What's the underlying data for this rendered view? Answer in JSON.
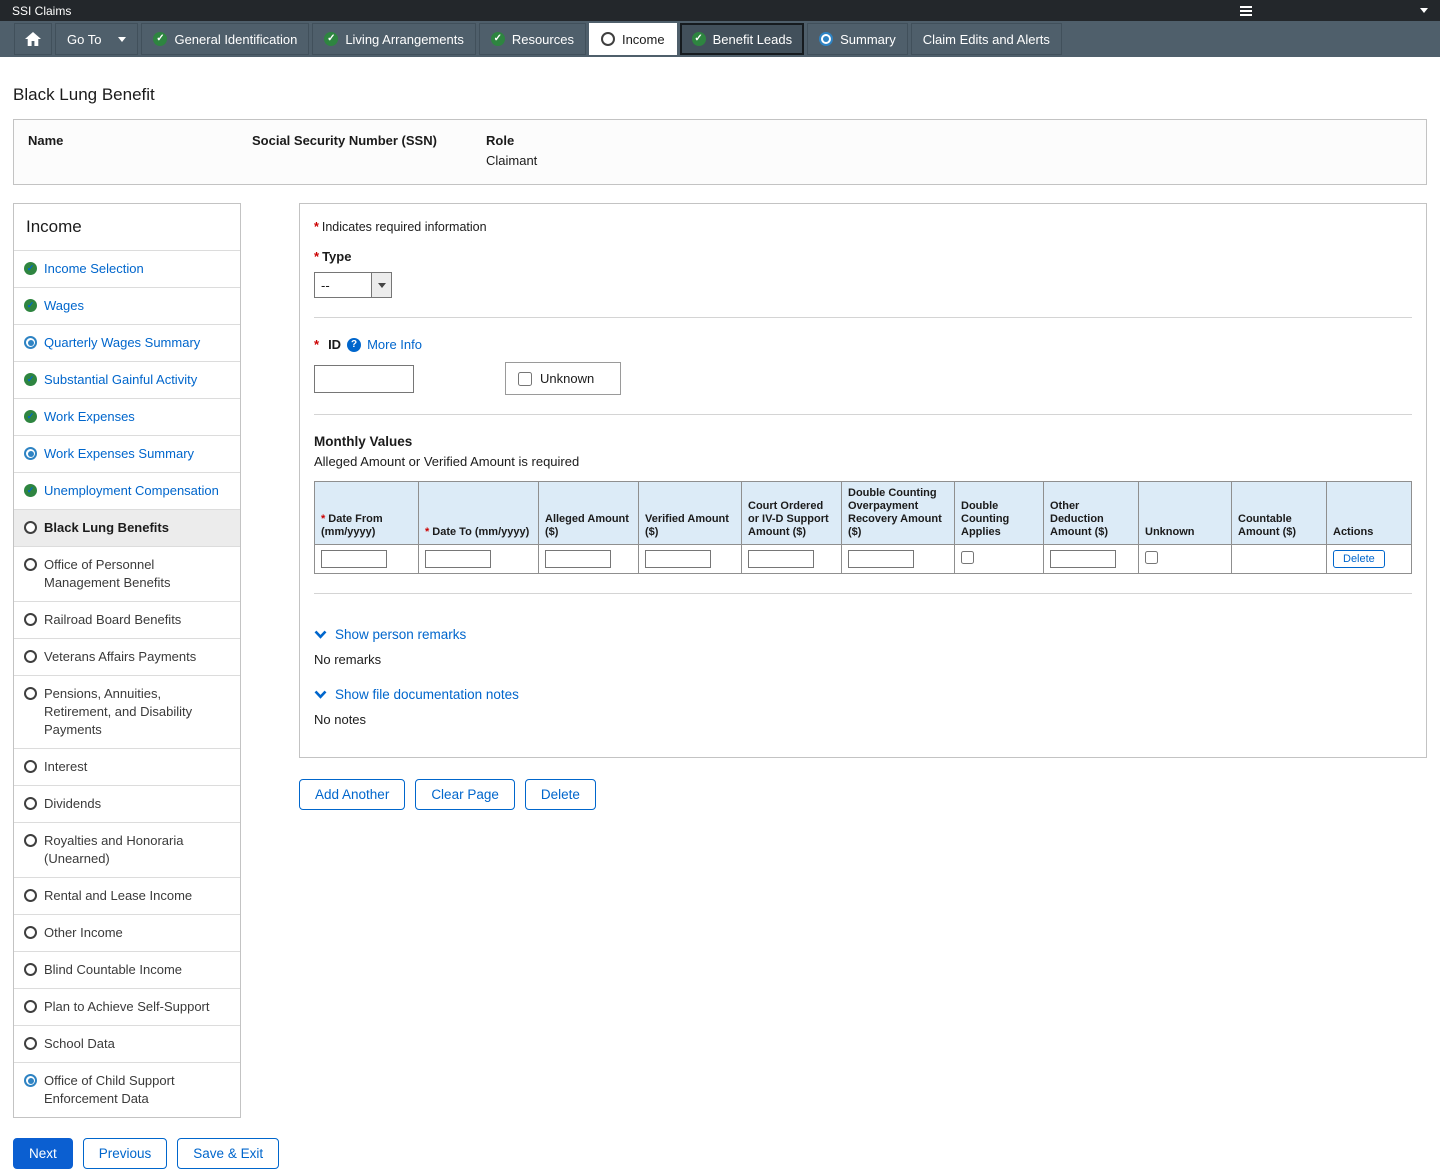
{
  "colors": {
    "accent_blue": "#0066cc",
    "primary_button_blue": "#0b5fd1",
    "complete_green": "#2e8540",
    "inprogress_blue": "#2e83c3",
    "required_red": "#cc0000",
    "table_header_bg": "#dcebf7",
    "topbar_bg": "#23272b",
    "navbar_bg": "#4f5f6b"
  },
  "app": {
    "title": "SSI Claims"
  },
  "nav": {
    "go_to_label": "Go To",
    "tabs": [
      {
        "label": "General Identification",
        "status": "complete"
      },
      {
        "label": "Living Arrangements",
        "status": "complete"
      },
      {
        "label": "Resources",
        "status": "complete"
      },
      {
        "label": "Income",
        "status": "notstarted",
        "active": true
      },
      {
        "label": "Benefit Leads",
        "status": "complete",
        "focused": true
      },
      {
        "label": "Summary",
        "status": "inprogress"
      },
      {
        "label": "Claim Edits and Alerts",
        "status": "none"
      }
    ]
  },
  "page": {
    "title": "Black Lung Benefit"
  },
  "claimant": {
    "name_label": "Name",
    "name_value": "",
    "ssn_label": "Social Security Number (SSN)",
    "ssn_value": "",
    "role_label": "Role",
    "role_value": "Claimant"
  },
  "sidebar": {
    "title": "Income",
    "items": [
      {
        "label": "Income Selection",
        "status": "complete",
        "link": true
      },
      {
        "label": "Wages",
        "status": "complete",
        "link": true
      },
      {
        "label": "Quarterly Wages Summary",
        "status": "inprogress",
        "link": true
      },
      {
        "label": "Substantial Gainful Activity",
        "status": "complete",
        "link": true
      },
      {
        "label": "Work Expenses",
        "status": "complete",
        "link": true
      },
      {
        "label": "Work Expenses Summary",
        "status": "inprogress",
        "link": true
      },
      {
        "label": "Unemployment Compensation",
        "status": "complete",
        "link": true
      },
      {
        "label": "Black Lung Benefits",
        "status": "notstarted",
        "current": true
      },
      {
        "label": "Office of Personnel Management Benefits",
        "status": "notstarted"
      },
      {
        "label": "Railroad Board Benefits",
        "status": "notstarted"
      },
      {
        "label": "Veterans Affairs Payments",
        "status": "notstarted"
      },
      {
        "label": "Pensions, Annuities, Retirement, and Disability Payments",
        "status": "notstarted"
      },
      {
        "label": "Interest",
        "status": "notstarted"
      },
      {
        "label": "Dividends",
        "status": "notstarted"
      },
      {
        "label": "Royalties and Honoraria (Unearned)",
        "status": "notstarted"
      },
      {
        "label": "Rental and Lease Income",
        "status": "notstarted"
      },
      {
        "label": "Other Income",
        "status": "notstarted"
      },
      {
        "label": "Blind Countable Income",
        "status": "notstarted"
      },
      {
        "label": "Plan to Achieve Self-Support",
        "status": "notstarted"
      },
      {
        "label": "School Data",
        "status": "notstarted"
      },
      {
        "label": "Office of Child Support Enforcement Data",
        "status": "inprogress"
      }
    ]
  },
  "form": {
    "required_note": "Indicates required information",
    "type": {
      "label": "Type",
      "value": "--"
    },
    "id": {
      "label": "ID",
      "more_info_label": "More Info",
      "value": "",
      "unknown_label": "Unknown",
      "unknown_checked": false
    },
    "monthly_values": {
      "title": "Monthly Values",
      "subtitle": "Alleged Amount or Verified Amount is required"
    },
    "table": {
      "delete_label": "Delete",
      "columns": [
        {
          "label": "Date From (mm/yyyy)",
          "required": true,
          "type": "text"
        },
        {
          "label": "Date To (mm/yyyy)",
          "required": true,
          "type": "text"
        },
        {
          "label": "Alleged Amount ($)",
          "type": "text"
        },
        {
          "label": "Verified Amount ($)",
          "type": "text"
        },
        {
          "label": "Court Ordered or IV-D Support Amount ($)",
          "type": "text"
        },
        {
          "label": "Double Counting Overpayment Recovery Amount ($)",
          "type": "text"
        },
        {
          "label": "Double Counting Applies",
          "type": "checkbox"
        },
        {
          "label": "Other Deduction Amount ($)",
          "type": "text"
        },
        {
          "label": "Unknown",
          "type": "checkbox"
        },
        {
          "label": "Countable Amount ($)",
          "type": "none"
        },
        {
          "label": "Actions",
          "type": "delete"
        }
      ]
    },
    "person_remarks": {
      "toggle_label": "Show person remarks",
      "empty_text": "No remarks"
    },
    "file_notes": {
      "toggle_label": "Show file documentation notes",
      "empty_text": "No notes"
    },
    "buttons": {
      "add_another": "Add Another",
      "clear_page": "Clear Page",
      "delete": "Delete"
    }
  },
  "footer": {
    "next": "Next",
    "previous": "Previous",
    "save_exit": "Save & Exit"
  }
}
